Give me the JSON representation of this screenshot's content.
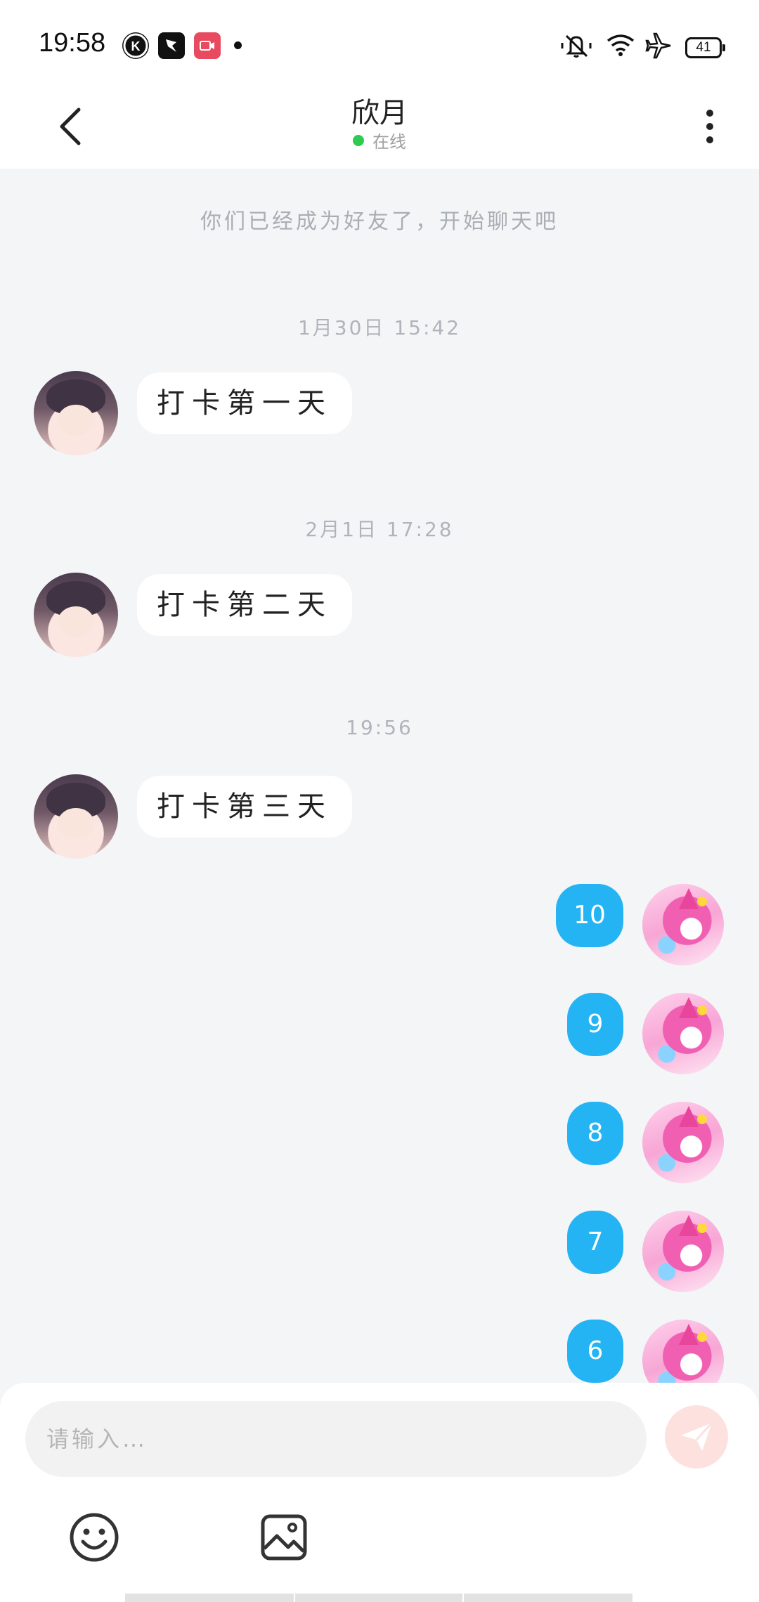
{
  "status_bar": {
    "time": "19:58",
    "battery": "41",
    "icons": [
      "k-app-icon",
      "feather-app-icon",
      "video-app-icon",
      "notification-dot",
      "mute-icon",
      "wifi-icon",
      "airplane-mode-icon",
      "battery-icon"
    ]
  },
  "header": {
    "title": "欣月",
    "status": "在线",
    "status_color": "#2fcb4f"
  },
  "chat": {
    "system_note": "你们已经成为好友了，开始聊天吧",
    "timestamps": [
      "1月30日 15:42",
      "2月1日 17:28",
      "19:56"
    ],
    "incoming_messages": [
      "打卡第一天",
      "打卡第二天",
      "打卡第三天"
    ],
    "outgoing_messages": [
      "10",
      "9",
      "8",
      "7",
      "6"
    ],
    "outgoing_bubble_color": "#25b4f3"
  },
  "input_bar": {
    "placeholder": "请输入…",
    "send_button_color": "#fde1df",
    "tools": [
      "emoji-icon",
      "image-icon"
    ]
  }
}
